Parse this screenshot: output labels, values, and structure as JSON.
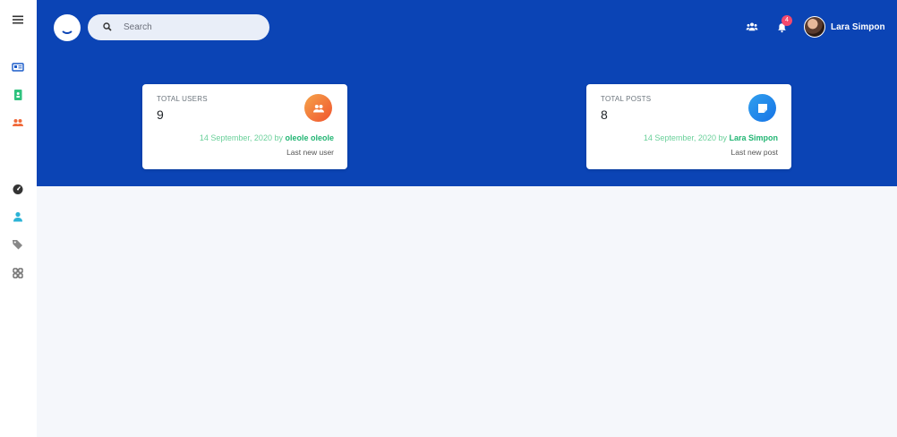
{
  "search": {
    "placeholder": "Search"
  },
  "header": {
    "user_name": "Lara Simpon",
    "notifications_count": "4",
    "accent_color": "#0b44b5"
  },
  "sidebar": {
    "items": [
      {
        "icon": "id-card-icon",
        "color": "#1a5bc9"
      },
      {
        "icon": "address-book-icon",
        "color": "#2ec27e"
      },
      {
        "icon": "users-icon",
        "color": "#f06a3a"
      },
      {
        "icon": "dashboard-gauge-icon",
        "color": "#333333"
      },
      {
        "icon": "user-icon",
        "color": "#2bb3d6"
      },
      {
        "icon": "tags-icon",
        "color": "#888888"
      },
      {
        "icon": "grid-icon",
        "color": "#555555"
      }
    ]
  },
  "cards": [
    {
      "label": "TOTAL USERS",
      "value": "9",
      "icon": "users-icon",
      "meta_prefix": "14 September, 2020 by",
      "meta_name": "oleole oleole",
      "sub": "Last new user"
    },
    {
      "label": "TOTAL POSTS",
      "value": "8",
      "icon": "note-icon",
      "meta_prefix": "14 September, 2020 by",
      "meta_name": "Lara Simpon",
      "sub": "Last new post"
    }
  ]
}
